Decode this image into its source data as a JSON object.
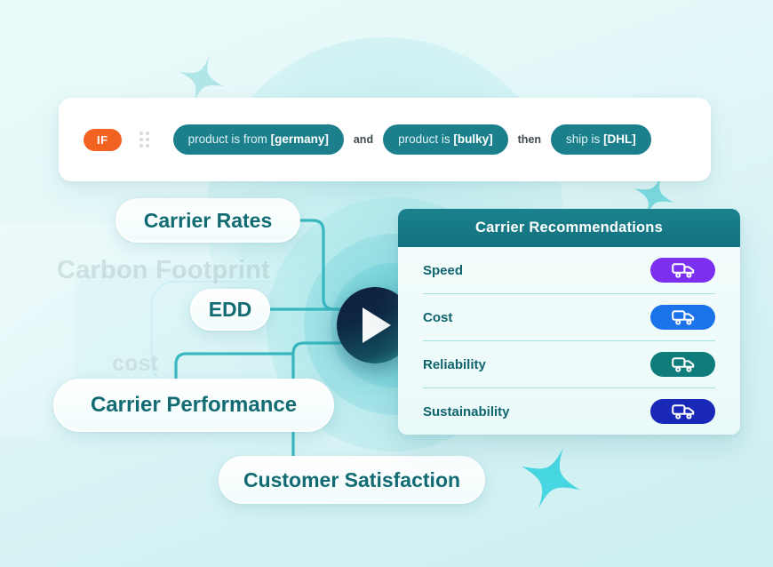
{
  "rule_builder": {
    "badge_label": "IF",
    "drag_handle_icon": "drag-dots-icon",
    "conditions": [
      {
        "prefix": "product is from ",
        "value": "[germany]"
      },
      {
        "prefix": "product is ",
        "value": "[bulky]"
      }
    ],
    "connector_and": "and",
    "connector_then": "then",
    "action": {
      "prefix": "ship is ",
      "value": "[DHL]"
    },
    "colors": {
      "badge_bg": "#f26322",
      "chip_bg": "#1b7f8c",
      "card_bg": "#ffffff"
    }
  },
  "mindmap": {
    "play_button_icon": "play-triangle-icon",
    "nodes": [
      {
        "id": "carrier-rates",
        "label": "Carrier Rates"
      },
      {
        "id": "edd",
        "label": "EDD"
      },
      {
        "id": "carrier-performance",
        "label": "Carrier Performance"
      },
      {
        "id": "customer-satisfaction",
        "label": "Customer Satisfaction"
      }
    ],
    "ghost_labels": [
      {
        "id": "carbon-footprint",
        "label": "Carbon Footprint"
      },
      {
        "id": "cost",
        "label": "cost"
      }
    ],
    "node_text_color": "#126b72",
    "connector_color": "#31b4bd"
  },
  "recommendations_panel": {
    "title": "Carrier Recommendations",
    "header_bg": "#177986",
    "rows": [
      {
        "label": "Speed",
        "icon": "truck-icon",
        "pill_color": "#7b2ff0"
      },
      {
        "label": "Cost",
        "icon": "truck-icon",
        "pill_color": "#1a73e8"
      },
      {
        "label": "Reliability",
        "icon": "truck-icon",
        "pill_color": "#0e7c7b"
      },
      {
        "label": "Sustainability",
        "icon": "truck-icon",
        "pill_color": "#1a28b8"
      }
    ]
  },
  "decorations": {
    "sparkles": [
      {
        "id": "sparkle-top-left",
        "color": "#a7e3e6"
      },
      {
        "id": "sparkle-top-right",
        "color": "#6fd8de"
      },
      {
        "id": "sparkle-bottom-center",
        "color": "#3fd5e0"
      }
    ],
    "background_gradient": [
      "#eafaf9",
      "#cdeff2"
    ]
  }
}
